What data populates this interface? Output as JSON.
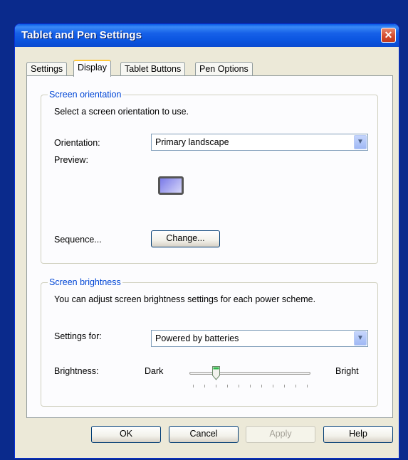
{
  "window": {
    "title": "Tablet and Pen Settings",
    "close_glyph": "✕"
  },
  "tabs": [
    "Settings",
    "Display",
    "Tablet Buttons",
    "Pen Options"
  ],
  "active_tab": "Display",
  "orientation_group": {
    "legend": "Screen orientation",
    "description": "Select a screen orientation to use.",
    "orientation_label": "Orientation:",
    "orientation_value": "Primary landscape",
    "preview_label": "Preview:",
    "sequence_label": "Sequence...",
    "change_button": "Change..."
  },
  "brightness_group": {
    "legend": "Screen brightness",
    "description": "You can adjust screen brightness settings for each power scheme.",
    "settings_for_label": "Settings for:",
    "settings_for_value": "Powered by batteries",
    "brightness_label": "Brightness:",
    "dark_label": "Dark",
    "bright_label": "Bright",
    "brightness_level": 2,
    "brightness_max": 10
  },
  "buttons": {
    "ok": "OK",
    "cancel": "Cancel",
    "apply": "Apply",
    "help": "Help"
  },
  "icons": {
    "dropdown": "chevron-down-icon",
    "close": "close-icon",
    "preview": "monitor-icon"
  },
  "colors": {
    "accent": "#0046d5",
    "titlebar": "#0b55e0"
  }
}
